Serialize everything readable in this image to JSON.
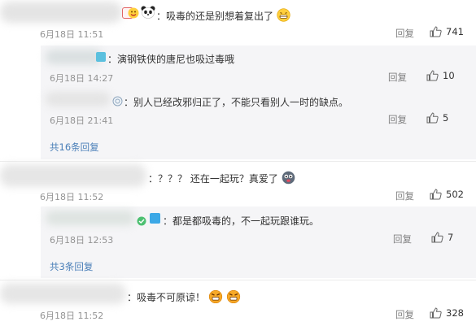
{
  "labels": {
    "reply": "回复"
  },
  "colors": {
    "link": "#4a7fb8",
    "subbox_bg": "#f5f5f7",
    "meta": "#939393"
  },
  "comments": [
    {
      "text": "：吸毒的还是别想着复出了",
      "time": "6月18日 11:51",
      "likes": "741",
      "replies": [
        {
          "text": "：演钢铁侠的唐尼也吸过毒哦",
          "time": "6月18日 14:27",
          "likes": "10"
        },
        {
          "text": "：别人已经改邪归正了，不能只看别人一时的缺点。",
          "time": "6月18日 21:41",
          "likes": "5"
        }
      ],
      "more": "共16条回复"
    },
    {
      "text": "：？？？ 还在一起玩？真爱了",
      "time": "6月18日 11:52",
      "likes": "502",
      "replies": [
        {
          "text": "：都是都吸毒的，不一起玩跟谁玩。",
          "time": "6月18日 12:53",
          "likes": "7"
        }
      ],
      "more": "共3条回复"
    },
    {
      "text": "：吸毒不可原谅！",
      "time": "6月18日 11:52",
      "likes": "328"
    }
  ]
}
